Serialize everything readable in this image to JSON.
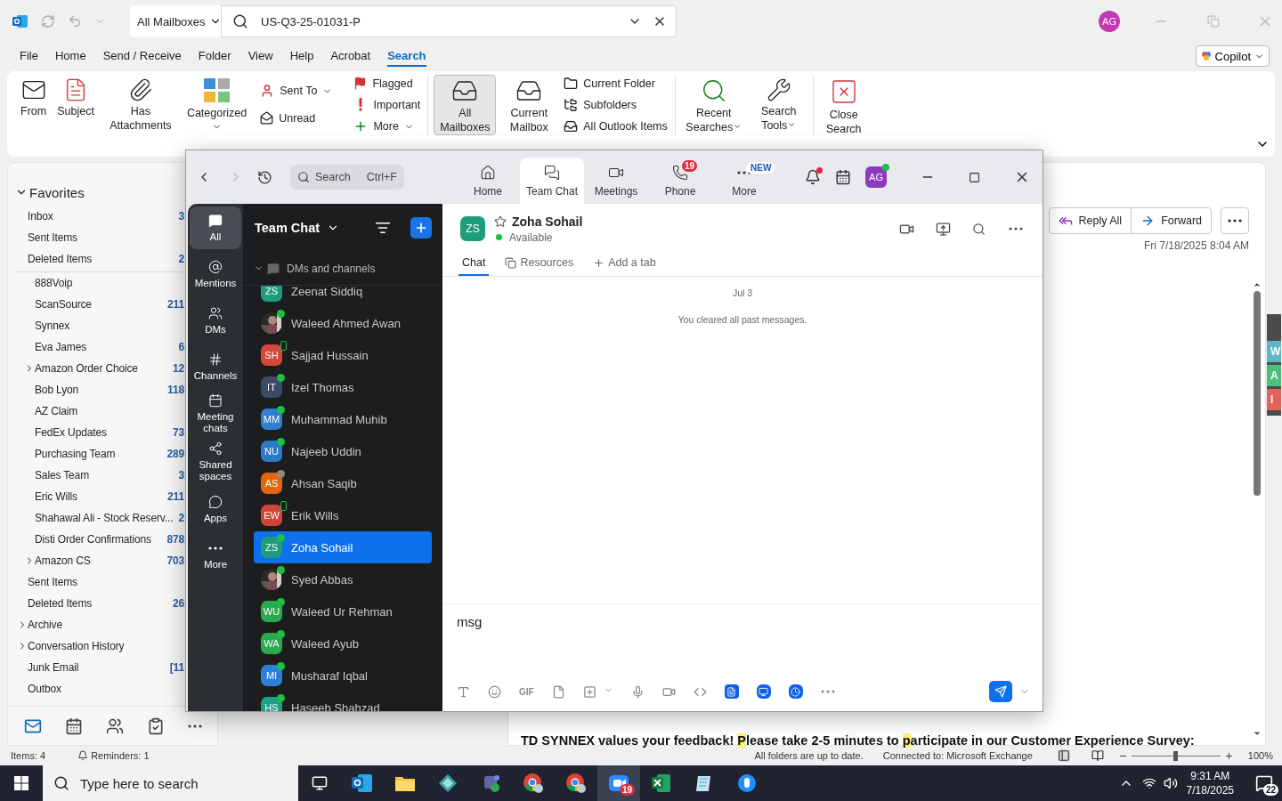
{
  "outlook": {
    "title_bar": {
      "scope": "All Mailboxes",
      "search_value": "US-Q3-25-01031-P",
      "avatar": "AG"
    },
    "menu_tabs": [
      {
        "label": "File",
        "selected": false
      },
      {
        "label": "Home",
        "selected": false
      },
      {
        "label": "Send / Receive",
        "selected": false
      },
      {
        "label": "Folder",
        "selected": false
      },
      {
        "label": "View",
        "selected": false
      },
      {
        "label": "Help",
        "selected": false
      },
      {
        "label": "Acrobat",
        "selected": false
      },
      {
        "label": "Search",
        "selected": true
      }
    ],
    "copilot": "Copilot",
    "ribbon": {
      "refine_buttons": [
        {
          "label": "From"
        },
        {
          "label": "Subject"
        },
        {
          "label": "Has Attachments"
        },
        {
          "label": "Categorized",
          "dropdown": true
        }
      ],
      "refine_filters": [
        {
          "label": "Sent To",
          "dropdown": true
        },
        {
          "label": "Unread"
        },
        {
          "label": "Flagged"
        },
        {
          "label": "Important"
        },
        {
          "label": "More",
          "dropdown": true
        }
      ],
      "scope_buttons": [
        {
          "label": "All Mailboxes",
          "selected": true
        },
        {
          "label": "Current Mailbox",
          "selected": false
        }
      ],
      "scope_options": [
        {
          "label": "Current Folder"
        },
        {
          "label": "Subfolders"
        },
        {
          "label": "All Outlook Items"
        }
      ],
      "options_buttons": [
        {
          "label": "Recent Searches",
          "dropdown": true
        },
        {
          "label": "Search Tools",
          "dropdown": true
        }
      ],
      "close_button": "Close Search"
    },
    "folder_pane": {
      "favorites": {
        "label": "Favorites",
        "expanded": true,
        "items": [
          {
            "name": "Inbox",
            "count": "3"
          },
          {
            "name": "Sent Items"
          },
          {
            "name": "Deleted Items",
            "count": "2"
          }
        ]
      },
      "inbox_subfolders": [
        {
          "name": "888Voip"
        },
        {
          "name": "ScanSource",
          "count": "211"
        },
        {
          "name": "Synnex"
        },
        {
          "name": "Eva James",
          "count": "6"
        },
        {
          "name": "Amazon Order Choice",
          "count": "12",
          "expanded": false
        },
        {
          "name": "Bob Lyon",
          "count": "118"
        },
        {
          "name": "AZ Claim"
        },
        {
          "name": "FedEx Updates",
          "count": "73"
        },
        {
          "name": "Purchasing Team",
          "count": "289"
        },
        {
          "name": "Sales Team",
          "count": "3"
        },
        {
          "name": "Eric Wills",
          "count": "211"
        },
        {
          "name": "Shahawal Ali - Stock Reserv...",
          "count": "2"
        },
        {
          "name": "Disti Order Confirmations",
          "count": "878"
        },
        {
          "name": "Amazon CS",
          "count": "703",
          "expanded": false
        }
      ],
      "folders": [
        {
          "name": "Sent Items"
        },
        {
          "name": "Deleted Items",
          "count": "26"
        },
        {
          "name": "Archive",
          "expanded": false
        },
        {
          "name": "Conversation History",
          "expanded": false
        },
        {
          "name": "Junk Email",
          "count": "[11"
        },
        {
          "name": "Outbox"
        }
      ]
    },
    "reading_pane": {
      "actions": [
        {
          "label": "Reply All"
        },
        {
          "label": "Forward"
        }
      ],
      "date": "Fri 7/18/2025 8:04 AM",
      "body_line": [
        {
          "text": "TD SYNNEX values your feedback! ",
          "highlight": false
        },
        {
          "text": "P",
          "highlight": true
        },
        {
          "text": "lease take 2-5 minutes to ",
          "highlight": false
        },
        {
          "text": "p",
          "highlight": true
        },
        {
          "text": "articipate in our Customer Experience Survey:",
          "highlight": false
        }
      ],
      "side_tabs": [
        {
          "label": "W",
          "color": "#5fb4c6"
        },
        {
          "label": "A",
          "color": "#4dbf79"
        },
        {
          "label": "I",
          "color": "#e3635b"
        }
      ]
    },
    "status_bar": {
      "items": "Items: 4",
      "reminders": "Reminders: 1",
      "sync": "All folders are up to date.",
      "connection": "Connected to: Microsoft Exchange",
      "zoom": {
        "level": 0.5,
        "reading": "100%"
      }
    }
  },
  "zoom": {
    "search": {
      "placeholder": "Search",
      "shortcut": "Ctrl+F"
    },
    "nav_tabs": [
      {
        "label": "Home",
        "selected": false
      },
      {
        "label": "Team Chat",
        "selected": true
      },
      {
        "label": "Meetings",
        "selected": false
      },
      {
        "label": "Phone",
        "selected": false,
        "badge": "19"
      },
      {
        "label": "More",
        "selected": false,
        "tag": "NEW"
      }
    ],
    "notifications_unread": true,
    "avatar": {
      "initials": "AG",
      "online": true
    },
    "rail": [
      {
        "label": "All",
        "selected": true
      },
      {
        "label": "Mentions",
        "selected": false
      },
      {
        "label": "DMs",
        "selected": false
      },
      {
        "label": "Channels",
        "selected": false
      },
      {
        "label": "Meeting chats",
        "selected": false
      },
      {
        "label": "Shared spaces",
        "selected": false
      },
      {
        "label": "Apps",
        "selected": false
      },
      {
        "label": "More",
        "selected": false
      }
    ],
    "list": {
      "title": "Team Chat",
      "section": {
        "label": "DMs and channels",
        "expanded": true
      },
      "contacts": [
        {
          "name": "Zeenat Siddiq",
          "kind": "initials",
          "initials": "ZS",
          "color": "#1f9c7c",
          "selected": false
        },
        {
          "name": "Waleed Ahmed Awan",
          "kind": "picture",
          "presence": {
            "kind": "dot",
            "color": "#1ebf45"
          },
          "selected": false
        },
        {
          "name": "Sajjad Hussain",
          "kind": "initials",
          "initials": "SH",
          "color": "#d4473b",
          "presence": {
            "kind": "phone",
            "color": "#1ebf45"
          },
          "selected": false
        },
        {
          "name": "Izel Thomas",
          "kind": "initials",
          "initials": "IT",
          "color": "#3b4a66",
          "presence": {
            "kind": "dot",
            "color": "#1ebf45"
          },
          "selected": false
        },
        {
          "name": "Muhammad Muhib",
          "kind": "initials",
          "initials": "MM",
          "color": "#2f80d1",
          "presence": {
            "kind": "dot",
            "color": "#1ebf45"
          },
          "selected": false
        },
        {
          "name": "Najeeb Uddin",
          "kind": "initials",
          "initials": "NU",
          "color": "#2b7cc8",
          "presence": {
            "kind": "dot",
            "color": "#1ebf45"
          },
          "selected": false
        },
        {
          "name": "Ahsan Saqib",
          "kind": "initials",
          "initials": "AS",
          "color": "#e2650f",
          "presence": {
            "kind": "dot",
            "color": "#8a8a8a"
          },
          "selected": false
        },
        {
          "name": "Erik Wills",
          "kind": "initials",
          "initials": "EW",
          "color": "#d0453a",
          "presence": {
            "kind": "phone",
            "color": "#1ebf45"
          },
          "selected": false
        },
        {
          "name": "Zoha Sohail",
          "kind": "initials",
          "initials": "ZS",
          "color": "#1f9c7c",
          "presence": {
            "kind": "dot",
            "color": "#1ebf45"
          },
          "selected": true
        },
        {
          "name": "Syed Abbas",
          "kind": "picture",
          "presence": {
            "kind": "dot",
            "color": "#1ebf45"
          },
          "selected": false
        },
        {
          "name": "Waleed Ur Rehman",
          "kind": "initials",
          "initials": "WU",
          "color": "#2aa951",
          "presence": {
            "kind": "dot",
            "color": "#1ebf45"
          },
          "selected": false
        },
        {
          "name": "Waleed Ayub",
          "kind": "initials",
          "initials": "WA",
          "color": "#2aa951",
          "presence": {
            "kind": "dot",
            "color": "#1ebf45"
          },
          "selected": false
        },
        {
          "name": "Musharaf Iqbal",
          "kind": "initials",
          "initials": "MI",
          "color": "#2f7fd6",
          "presence": {
            "kind": "dot",
            "color": "#1ebf45"
          },
          "selected": false
        },
        {
          "name": "Haseeb Shahzad",
          "kind": "initials",
          "initials": "HS",
          "color": "#1f9e88",
          "presence": {
            "kind": "dot",
            "color": "#1ebf45"
          },
          "selected": false
        }
      ]
    },
    "chat": {
      "initials": "ZS",
      "color": "#1f9c7c",
      "name": "Zoha Sohail",
      "starred": false,
      "presence": "Available",
      "tabs": [
        {
          "label": "Chat",
          "selected": true
        },
        {
          "label": "Resources",
          "selected": false
        },
        {
          "label": "Add a tab",
          "selected": false
        }
      ],
      "date": "Jul 3",
      "notice": "You cleared all past messages.",
      "composer_value": "msg",
      "gif_label": "GIF"
    }
  },
  "taskbar": {
    "search_placeholder": "Type here to search",
    "zoom_badge": "19",
    "time": "9:31 AM",
    "date": "7/18/2025",
    "notifications": "22"
  }
}
